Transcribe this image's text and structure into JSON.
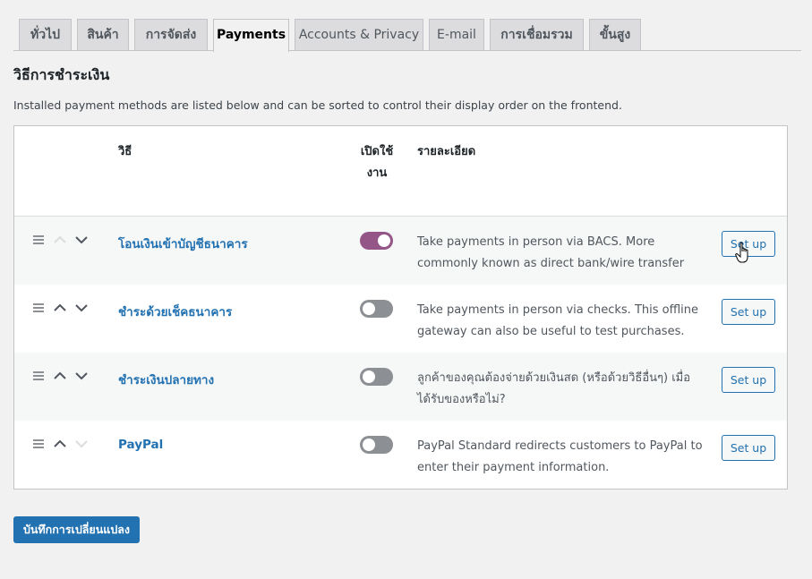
{
  "tabs": [
    {
      "label": "ทั่วไป",
      "active": false
    },
    {
      "label": "สินค้า",
      "active": false
    },
    {
      "label": "การจัดส่ง",
      "active": false
    },
    {
      "label": "Payments",
      "active": true
    },
    {
      "label": "Accounts & Privacy",
      "active": false
    },
    {
      "label": "E-mail",
      "active": false
    },
    {
      "label": "การเชื่อมรวม",
      "active": false
    },
    {
      "label": "ขั้นสูง",
      "active": false
    }
  ],
  "section_title": "วิธีการชำระเงิน",
  "description": "Installed payment methods are listed below and can be sorted to control their display order on the frontend.",
  "table": {
    "headers": {
      "method": "วิธี",
      "enabled": "เปิดใช้งาน",
      "details": "รายละเอียด"
    },
    "rows": [
      {
        "name": "โอนเงินเข้าบัญชีธนาคาร",
        "enabled": true,
        "description": "Take payments in person via BACS. More commonly known as direct bank/wire transfer",
        "action": "Set up",
        "can_move_up": false,
        "can_move_down": true
      },
      {
        "name": "ชำระด้วยเช็คธนาคาร",
        "enabled": false,
        "description": "Take payments in person via checks. This offline gateway can also be useful to test purchases.",
        "action": "Set up",
        "can_move_up": true,
        "can_move_down": true
      },
      {
        "name": "ชำระเงินปลายทาง",
        "enabled": false,
        "description": "ลูกค้าของคุณต้องจ่ายด้วยเงินสด (หรือด้วยวิธีอื่นๆ) เมื่อได้รับของหรือไม่?",
        "action": "Set up",
        "can_move_up": true,
        "can_move_down": true
      },
      {
        "name": "PayPal",
        "enabled": false,
        "description": "PayPal Standard redirects customers to PayPal to enter their payment information.",
        "action": "Set up",
        "can_move_up": true,
        "can_move_down": false
      }
    ]
  },
  "save_button": "บันทึกการเปลี่ยนแปลง",
  "colors": {
    "accent": "#2271b1",
    "toggle_on": "#935687",
    "toggle_off": "#8c8f94",
    "background": "#f1f1f1"
  },
  "icons": {
    "drag": "drag-handle-icon",
    "up": "chevron-up-icon",
    "down": "chevron-down-icon",
    "cursor": "hand-pointer-icon"
  }
}
